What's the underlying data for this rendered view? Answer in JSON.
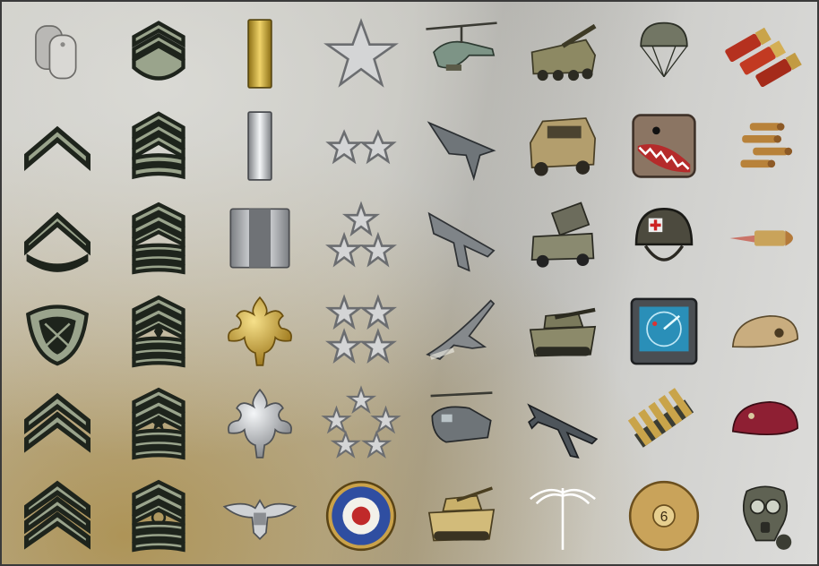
{
  "sheet": {
    "rows": 6,
    "columns": 8
  },
  "icons": [
    [
      "dog-tags-icon",
      "private-chevron-icon",
      "pfc-chevron-rocker-icon",
      "lance-corporal-crossed-rifles-icon",
      "corporal-double-chevron-icon",
      "sergeant-triple-chevron-icon"
    ],
    [
      "staff-sergeant-icon",
      "sergeant-first-class-icon",
      "master-sergeant-icon",
      "first-sergeant-diamond-icon",
      "sergeant-major-star-icon",
      "command-sergeant-major-wreath-icon"
    ],
    [
      "second-lieutenant-gold-bar-icon",
      "first-lieutenant-silver-bar-icon",
      "captain-double-bar-icon",
      "major-gold-oak-leaf-icon",
      "lieutenant-colonel-silver-oak-leaf-icon",
      "colonel-eagle-icon"
    ],
    [
      "one-star-general-icon",
      "two-star-general-icon",
      "three-star-general-icon",
      "four-star-general-icon",
      "five-star-general-icon",
      "roundel-patch-icon"
    ],
    [
      "attack-helicopter-icon",
      "stealth-bomber-icon",
      "fighter-jet-icon",
      "jet-launch-icon",
      "heavy-helicopter-icon",
      "armored-tank-icon"
    ],
    [
      "mobile-artillery-icon",
      "humvee-icon",
      "rocket-launcher-truck-icon",
      "main-battle-tank-icon",
      "cargo-plane-icon",
      "winged-emblem-icon"
    ],
    [
      "parachute-icon",
      "shark-mouth-patch-icon",
      "combat-helmet-icon",
      "radar-screen-icon",
      "ammo-belt-icon",
      "shell-casing-icon"
    ],
    [
      "shotgun-shells-icon",
      "bullets-icon",
      "tracer-bullet-icon",
      "tan-beret-icon",
      "maroon-beret-icon",
      "gas-mask-icon"
    ]
  ],
  "colors": {
    "chevron_fill": "#9aa48c",
    "chevron_stroke": "#1e241c",
    "gold": "#c9a22b",
    "silver": "#c9cccf",
    "vehicle": "#8a8a6a",
    "beret_tan": "#c9ad7f",
    "beret_maroon": "#8e1f33"
  },
  "roundel_text": "6"
}
